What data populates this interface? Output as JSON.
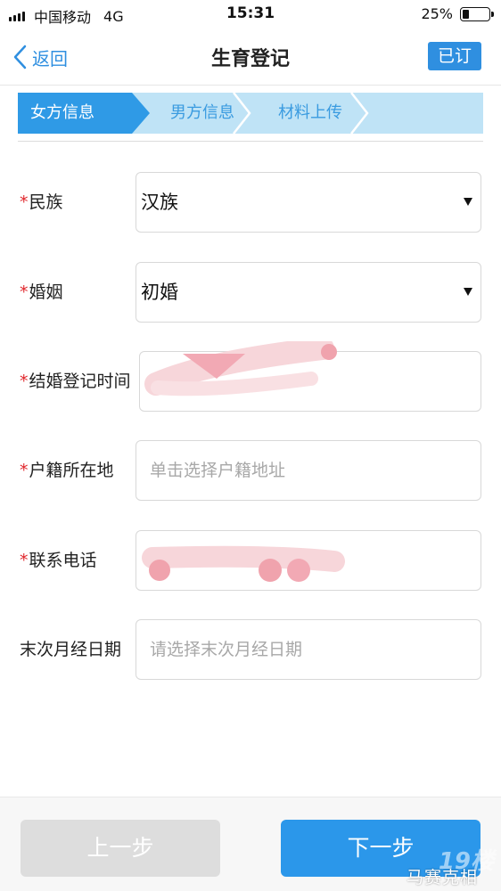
{
  "status_bar": {
    "carrier": "中国移动",
    "network": "4G",
    "time": "15:31",
    "battery_text": "25%",
    "battery_level": 0.25
  },
  "nav": {
    "back_label": "返回",
    "title": "生育登记",
    "action_label": "已订"
  },
  "steps": [
    {
      "label": "女方信息",
      "active": true
    },
    {
      "label": "男方信息",
      "active": false
    },
    {
      "label": "材料上传",
      "active": false
    }
  ],
  "form": {
    "required_mark": "*",
    "ethnicity": {
      "label": "民族",
      "value": "汉族"
    },
    "marriage": {
      "label": "婚姻",
      "value": "初婚"
    },
    "marriage_date": {
      "label": "结婚登记时间"
    },
    "household": {
      "label": "户籍所在地",
      "placeholder": "单击选择户籍地址"
    },
    "phone": {
      "label": "联系电话"
    },
    "last_period": {
      "label": "末次月经日期",
      "placeholder": "请选择末次月经日期"
    }
  },
  "buttons": {
    "prev_label": "上一步",
    "next_label": "下一步"
  },
  "watermark": {
    "logo": "19楼",
    "text": "马赛克相机"
  },
  "colors": {
    "accent": "#2f8fe0",
    "required": "#e0262b",
    "step_active": "#2f9ae6",
    "step_inactive": "#bfe3f6",
    "button_disabled": "#dddddd",
    "button_primary": "#2b97ea"
  }
}
